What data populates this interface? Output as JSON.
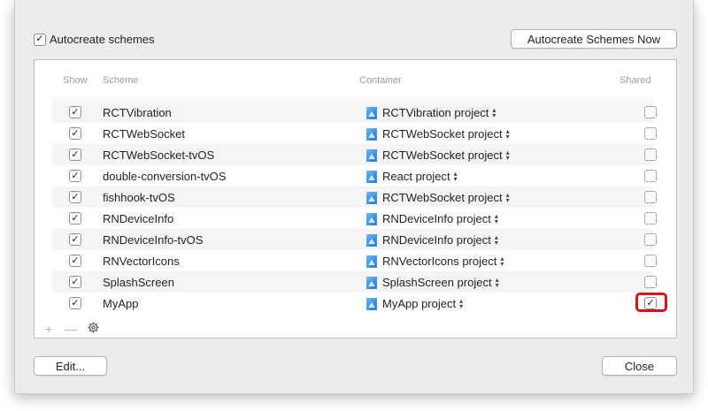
{
  "top": {
    "autocreate_label": "Autocreate schemes",
    "autocreate_checked": true,
    "autocreate_now_label": "Autocreate Schemes Now"
  },
  "table": {
    "headers": {
      "show": "Show",
      "scheme": "Scheme",
      "container": "Container",
      "shared": "Shared"
    },
    "rows": [
      {
        "show": true,
        "scheme": "RCTVibration",
        "container": "RCTVibration project",
        "shared": false
      },
      {
        "show": true,
        "scheme": "RCTWebSocket",
        "container": "RCTWebSocket project",
        "shared": false
      },
      {
        "show": true,
        "scheme": "RCTWebSocket-tvOS",
        "container": "RCTWebSocket project",
        "shared": false
      },
      {
        "show": true,
        "scheme": "double-conversion-tvOS",
        "container": "React project",
        "shared": false
      },
      {
        "show": true,
        "scheme": "fishhook-tvOS",
        "container": "RCTWebSocket project",
        "shared": false
      },
      {
        "show": true,
        "scheme": "RNDeviceInfo",
        "container": "RNDeviceInfo project",
        "shared": false
      },
      {
        "show": true,
        "scheme": "RNDeviceInfo-tvOS",
        "container": "RNDeviceInfo project",
        "shared": false
      },
      {
        "show": true,
        "scheme": "RNVectorIcons",
        "container": "RNVectorIcons project",
        "shared": false
      },
      {
        "show": true,
        "scheme": "SplashScreen",
        "container": "SplashScreen project",
        "shared": false
      },
      {
        "show": true,
        "scheme": "MyApp",
        "container": "MyApp project",
        "shared": true
      }
    ]
  },
  "footer": {
    "add_glyph": "+",
    "remove_glyph": "—",
    "gear_icon": "gear-icon",
    "edit_label": "Edit...",
    "close_label": "Close"
  },
  "colors": {
    "highlight": "#d8151b",
    "project_icon": "#1e7ad6"
  },
  "icons": {
    "checkmark": "✓",
    "updown": "⌃⌄"
  }
}
